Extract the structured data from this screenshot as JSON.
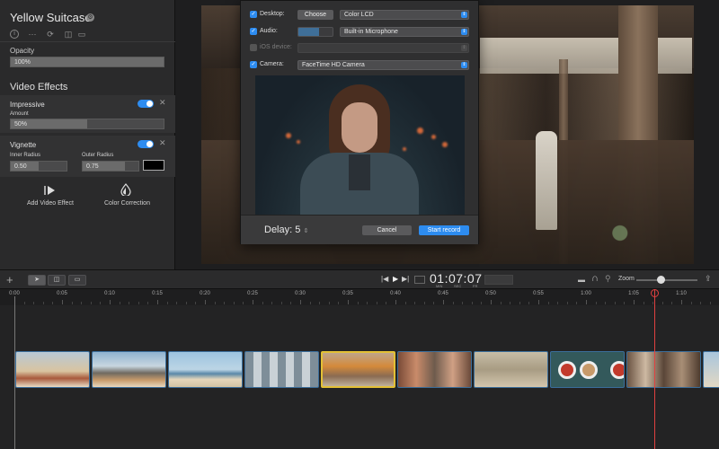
{
  "inspector": {
    "title": "Yellow Suitcase",
    "toolbar_icons": [
      "info-icon",
      "more-icon",
      "sync-icon",
      "split-icon",
      "layout-icon"
    ],
    "opacity": {
      "label": "Opacity",
      "value": "100%",
      "level": 1.0
    },
    "video_effects_title": "Video Effects",
    "effects": [
      {
        "name": "Impressive",
        "enabled": true,
        "param_label": "Amount",
        "param_value": "50%",
        "level": 0.5
      },
      {
        "name": "Vignette",
        "enabled": true,
        "inner_label": "Inner Radius",
        "inner_value": "0.50",
        "inner_level": 0.5,
        "outer_label": "Outer Radius",
        "outer_value": "0.75",
        "outer_level": 0.75
      }
    ],
    "add_effect_label": "Add Video Effect",
    "color_correction_label": "Color Correction"
  },
  "recorder": {
    "desktop": {
      "label": "Desktop:",
      "checked": true,
      "button": "Choose",
      "selection": "Color LCD"
    },
    "audio": {
      "label": "Audio:",
      "checked": true,
      "selection": "Built-in Microphone",
      "level": 0.6
    },
    "ios": {
      "label": "iOS device:",
      "checked": false,
      "selection": ""
    },
    "camera": {
      "label": "Camera:",
      "checked": true,
      "selection": "FaceTime HD Camera"
    },
    "delay_label": "Delay:",
    "delay_value": "5",
    "cancel_label": "Cancel",
    "start_label": "Start record"
  },
  "toolbar": {
    "add_icon": "+",
    "timecode": "01:07:07",
    "timecode_units": [
      "MIN",
      "SEC",
      "FR"
    ],
    "zoom_label": "Zoom",
    "zoom_level": 0.4
  },
  "ruler": {
    "ticks": [
      "0:00",
      "0:05",
      "0:10",
      "0:15",
      "0:20",
      "0:25",
      "0:30",
      "0:35",
      "0:40",
      "0:45",
      "0:50",
      "0:55",
      "1:00",
      "1:05",
      "1:10"
    ]
  },
  "colors": {
    "accent": "#2d8cf0",
    "selected_clip": "#e3c035",
    "playhead": "#e04040"
  }
}
